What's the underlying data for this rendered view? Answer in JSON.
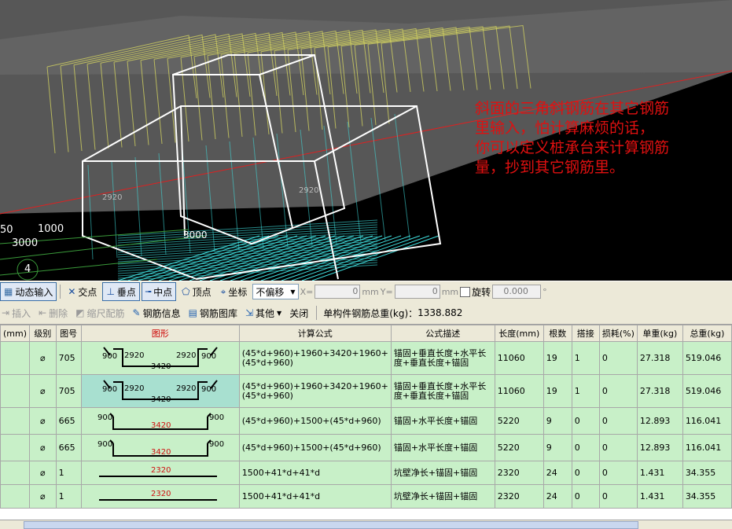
{
  "viewport": {
    "labels": {
      "dim_50": "50",
      "dim_1000": "1000",
      "dim_3000a": "3000",
      "dim_3000b": "3000",
      "dim_2920a": "2920",
      "dim_2920b": "2920",
      "axis_4": "4"
    },
    "annotation_lines": [
      "斜面的三角斜钢筋在其它钢筋",
      "里输入，怕计算麻烦的话，",
      "你可以定义桩承台来计算钢筋",
      "量，抄到其它钢筋里。"
    ],
    "annotation_color": "#e01010"
  },
  "toolbar1": {
    "dynamic_input": "动态输入",
    "intersection": "交点",
    "perpendicular": "垂点",
    "midpoint": "中点",
    "vertex": "顶点",
    "coordinate": "坐标",
    "offset_mode": "不偏移",
    "x_label": "X=",
    "x_value": "0",
    "mm1": "mm",
    "y_label": "Y=",
    "y_value": "0",
    "mm2": "mm",
    "rotate": "旋转",
    "rotate_value": "0.000",
    "degree": "°"
  },
  "toolbar2": {
    "insert": "插入",
    "delete": "删除",
    "scale_rebar": "缩尺配筋",
    "rebar_info": "钢筋信息",
    "rebar_library": "钢筋图库",
    "other": "其他",
    "close": "关闭",
    "total_weight_label": "单构件钢筋总重(kg)：",
    "total_weight_value": "1338.882"
  },
  "table": {
    "headers": [
      "(mm)",
      "级别",
      "图号",
      "图形",
      "计算公式",
      "公式描述",
      "长度(mm)",
      "根数",
      "搭接",
      "损耗(%)",
      "单重(kg)",
      "总重(kg)"
    ],
    "rows": [
      {
        "grade": "⌀",
        "fig": "705",
        "shape": {
          "type": "u",
          "a": "900",
          "b": "2920",
          "c": "3420",
          "d": "2920",
          "e": "900"
        },
        "formula": "(45*d+960)+1960+3420+1960+(45*d+960)",
        "desc": "锚固+垂直长度+水平长度+垂直长度+锚固",
        "length": "11060",
        "count": "19",
        "lap": "1",
        "loss": "0",
        "unit_w": "27.318",
        "total_w": "519.046"
      },
      {
        "grade": "⌀",
        "fig": "705",
        "shape": {
          "type": "u",
          "a": "900",
          "b": "2920",
          "c": "3420",
          "d": "2920",
          "e": "900"
        },
        "formula": "(45*d+960)+1960+3420+1960+(45*d+960)",
        "desc": "锚固+垂直长度+水平长度+垂直长度+锚固",
        "length": "11060",
        "count": "19",
        "lap": "1",
        "loss": "0",
        "unit_w": "27.318",
        "total_w": "519.046"
      },
      {
        "grade": "⌀",
        "fig": "665",
        "shape": {
          "type": "tray",
          "a": "900",
          "c": "3420",
          "e": "900"
        },
        "formula": "(45*d+960)+1500+(45*d+960)",
        "desc": "锚固+水平长度+锚固",
        "length": "5220",
        "count": "9",
        "lap": "0",
        "loss": "0",
        "unit_w": "12.893",
        "total_w": "116.041"
      },
      {
        "grade": "⌀",
        "fig": "665",
        "shape": {
          "type": "tray",
          "a": "900",
          "c": "3420",
          "e": "900"
        },
        "formula": "(45*d+960)+1500+(45*d+960)",
        "desc": "锚固+水平长度+锚固",
        "length": "5220",
        "count": "9",
        "lap": "0",
        "loss": "0",
        "unit_w": "12.893",
        "total_w": "116.041"
      },
      {
        "grade": "⌀",
        "fig": "1",
        "shape": {
          "type": "line",
          "c": "2320"
        },
        "formula": "1500+41*d+41*d",
        "desc": "坑壁净长+锚固+锚固",
        "length": "2320",
        "count": "24",
        "lap": "0",
        "loss": "0",
        "unit_w": "1.431",
        "total_w": "34.355"
      },
      {
        "grade": "⌀",
        "fig": "1",
        "shape": {
          "type": "line",
          "c": "2320"
        },
        "formula": "1500+41*d+41*d",
        "desc": "坑壁净长+锚固+锚固",
        "length": "2320",
        "count": "24",
        "lap": "0",
        "loss": "0",
        "unit_w": "1.431",
        "total_w": "34.355"
      }
    ]
  }
}
